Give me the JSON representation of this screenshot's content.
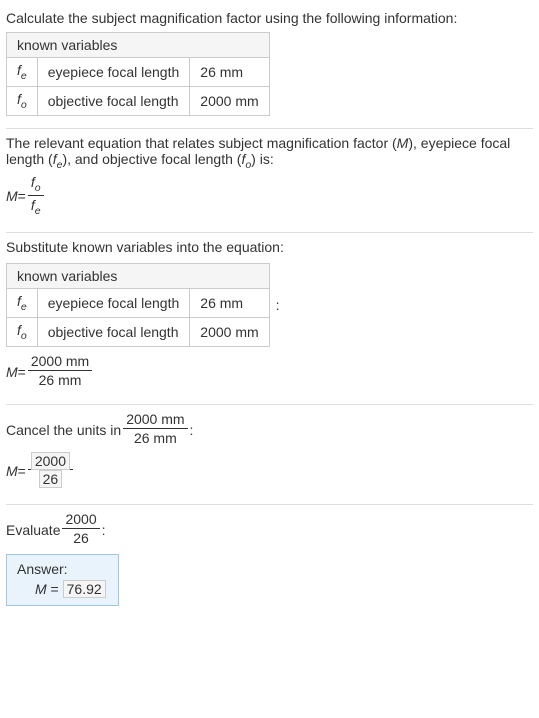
{
  "s1": {
    "intro": "Calculate the subject magnification factor using the following information:",
    "known_header": "known variables",
    "rows": [
      {
        "sym_var": "f",
        "sym_sub": "e",
        "desc": "eyepiece focal length",
        "val": "26 mm"
      },
      {
        "sym_var": "f",
        "sym_sub": "o",
        "desc": "objective focal length",
        "val": "2000 mm"
      }
    ]
  },
  "s2": {
    "text_a": "The relevant equation that relates subject magnification factor (",
    "M": "M",
    "text_b": "), eyepiece focal length (",
    "fe_var": "f",
    "fe_sub": "e",
    "text_c": "), and objective focal length (",
    "fo_var": "f",
    "fo_sub": "o",
    "text_d": ") is:",
    "eq_lhs": "M",
    "eq_eq": " = ",
    "num_var": "f",
    "num_sub": "o",
    "den_var": "f",
    "den_sub": "e"
  },
  "s3": {
    "intro": "Substitute known variables into the equation:",
    "known_header": "known variables",
    "rows": [
      {
        "sym_var": "f",
        "sym_sub": "e",
        "desc": "eyepiece focal length",
        "val": "26 mm"
      },
      {
        "sym_var": "f",
        "sym_sub": "o",
        "desc": "objective focal length",
        "val": "2000 mm"
      }
    ],
    "colon": ":",
    "eq_lhs": "M",
    "eq_eq": " = ",
    "num": "2000 mm",
    "den": "26 mm"
  },
  "s4": {
    "text_a": "Cancel the units in ",
    "frac_num": "2000 mm",
    "frac_den": "26 mm",
    "text_b": ":",
    "eq_lhs": "M",
    "eq_eq": " = ",
    "num": "2000",
    "den": "26"
  },
  "s5": {
    "text_a": "Evaluate ",
    "frac_num": "2000",
    "frac_den": "26",
    "text_b": ":",
    "ans_label": "Answer:",
    "ans_lhs": "M",
    "ans_eq": " = ",
    "ans_val": "76.92"
  }
}
